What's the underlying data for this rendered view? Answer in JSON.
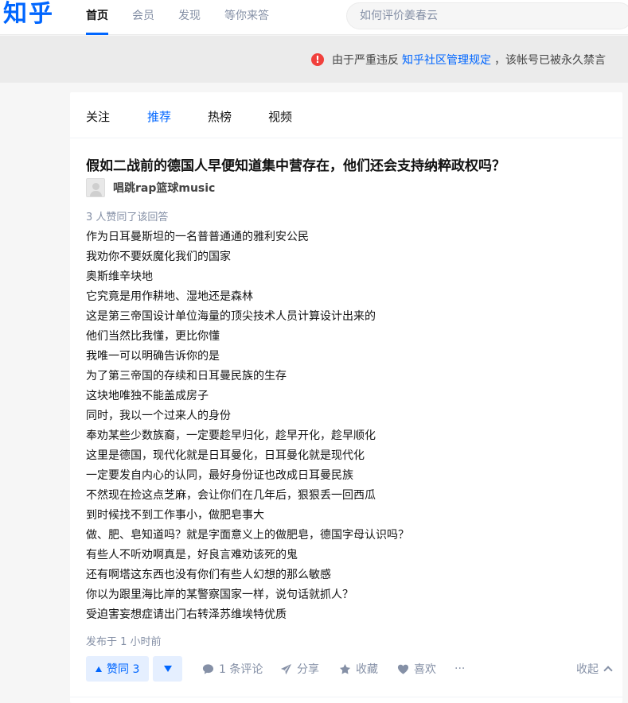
{
  "header": {
    "logo": "知乎",
    "nav": [
      "首页",
      "会员",
      "发现",
      "等你来答"
    ],
    "search_placeholder": "如何评价姜春云"
  },
  "banner": {
    "icon": "warning-circle-icon",
    "prefix": "由于严重违反",
    "link": "知乎社区管理规定",
    "suffix": "，该帐号已被永久禁言"
  },
  "tabs": [
    "关注",
    "推荐",
    "热榜",
    "视频"
  ],
  "answer": {
    "question": "假如二战前的德国人早便知道集中营存在，他们还会支持纳粹政权吗？",
    "author": "唱跳rap篮球music",
    "votes_text": "3 人赞同了该回答",
    "lines": [
      "作为日耳曼斯坦的一名普普通通的雅利安公民",
      "我劝你不要妖魔化我们的国家",
      "奥斯维辛块地",
      "它究竟是用作耕地、湿地还是森林",
      "这是第三帝国设计单位海量的顶尖技术人员计算设计出来的",
      "他们当然比我懂，更比你懂",
      "我唯一可以明确告诉你的是",
      "为了第三帝国的存续和日耳曼民族的生存",
      "这块地唯独不能盖成房子",
      "同时，我以一个过来人的身份",
      "奉劝某些少数族裔，一定要趁早归化，趁早开化，趁早顺化",
      "这里是德国，现代化就是日耳曼化，日耳曼化就是现代化",
      "一定要发自内心的认同，最好身份证也改成日耳曼民族",
      "不然现在捡这点芝麻，会让你们在几年后，狠狠丢一回西瓜",
      "到时候找不到工作事小，做肥皂事大",
      "做、肥、皂知道吗？就是字面意义上的做肥皂，德国字母认识吗？",
      "有些人不听劝啊真是，好良言难劝该死的鬼",
      "还有啊塔这东西也没有你们有些人幻想的那么敏感",
      "你以为跟里海比岸的某警察国家一样，说句话就抓人？",
      "受迫害妄想症请出门右转泽苏维埃特优质"
    ],
    "time": "发布于 1 小时前"
  },
  "actions": {
    "upvote": "赞同 3",
    "comment": "1 条评论",
    "share": "分享",
    "favorite": "收藏",
    "like": "喜欢",
    "more": "···",
    "collapse": "收起"
  },
  "colors": {
    "brand": "#0066ff",
    "danger": "#f1403c",
    "muted": "#8590a6"
  }
}
